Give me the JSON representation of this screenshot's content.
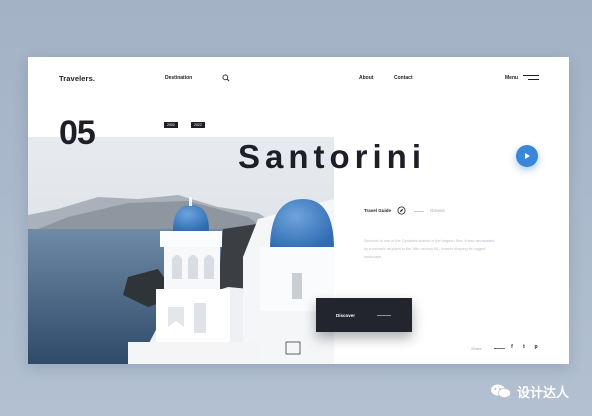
{
  "header": {
    "brand": "Travelers.",
    "nav_destination": "Destination",
    "nav_about": "About",
    "nav_contact": "Contact",
    "nav_menu": "Menu"
  },
  "hero": {
    "number": "05",
    "tags": [
      "2002",
      "2022"
    ],
    "title": "Santorini",
    "travel_guide": "Travel Guide",
    "country": "Greece",
    "description": "Santorini is one of the Cyclades islands in the Aegean Sea. It was devastated by a volcanic eruption in the 16th century BC, forever shaping its rugged landscape.",
    "discover_label": "Discover"
  },
  "share": {
    "label": "Share",
    "icons": [
      "facebook-icon",
      "twitter-icon",
      "pinterest-icon"
    ],
    "glyphs": [
      "f",
      "t",
      "p"
    ]
  },
  "watermark": {
    "text": "设计达人"
  },
  "colors": {
    "accent": "#3a86d8",
    "dark": "#1d1f26",
    "background": "#a9b8cb"
  }
}
